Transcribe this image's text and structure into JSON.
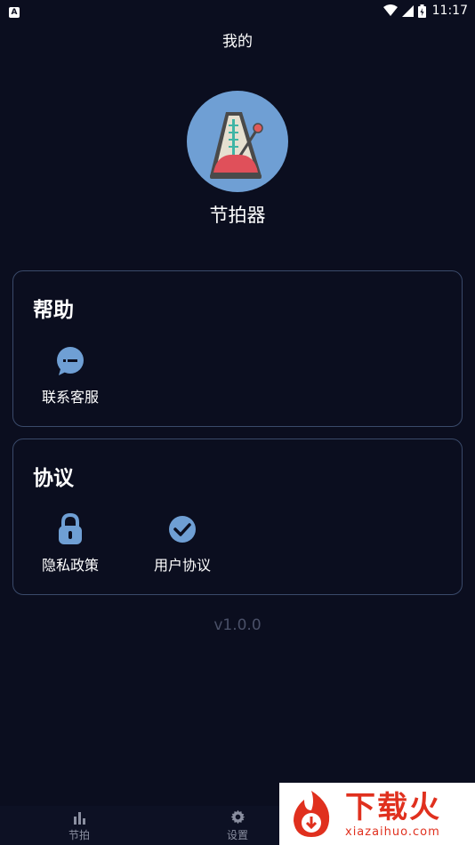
{
  "status_bar": {
    "time": "11:17",
    "left_icon": "a-notification-icon",
    "icons": [
      "wifi-icon",
      "signal-icon",
      "battery-icon"
    ]
  },
  "page": {
    "title": "我的"
  },
  "app": {
    "name": "节拍器",
    "logo_icon": "metronome-icon"
  },
  "help_section": {
    "title": "帮助",
    "items": [
      {
        "label": "联系客服",
        "icon": "chat-icon"
      }
    ]
  },
  "agreement_section": {
    "title": "协议",
    "items": [
      {
        "label": "隐私政策",
        "icon": "lock-icon"
      },
      {
        "label": "用户协议",
        "icon": "check-circle-icon"
      }
    ]
  },
  "version": "v1.0.0",
  "bottom_nav": {
    "tabs": [
      {
        "label": "节拍",
        "icon": "bar-chart-icon"
      },
      {
        "label": "设置",
        "icon": "gear-icon"
      }
    ]
  },
  "watermark": {
    "title": "下载火",
    "url": "xiazaihuo.com"
  },
  "colors": {
    "background": "#0b0e1f",
    "card_border": "#3a4a6a",
    "icon_blue": "#6f9fd4",
    "version_text": "#4a5068",
    "watermark_red": "#e0301e"
  }
}
